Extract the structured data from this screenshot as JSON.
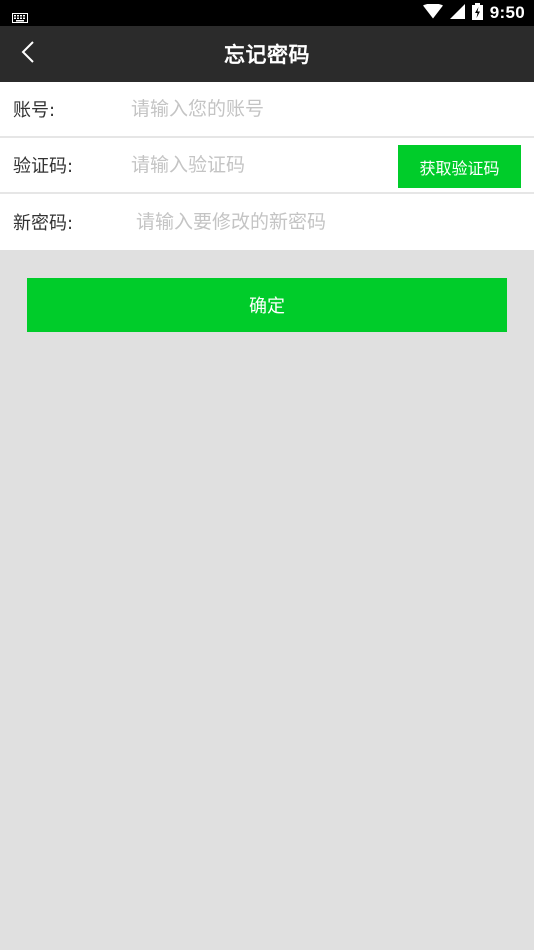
{
  "status_bar": {
    "time": "9:50",
    "icons": [
      "keyboard-icon",
      "wifi-icon",
      "cellular-signal-icon",
      "battery-charging-icon"
    ]
  },
  "header": {
    "title": "忘记密码",
    "back_icon": "chevron-left-icon"
  },
  "form": {
    "account": {
      "label": "账号:",
      "placeholder": "请输入您的账号",
      "value": ""
    },
    "code": {
      "label": "验证码:",
      "placeholder": "请输入验证码",
      "value": "",
      "get_code_label": "获取验证码"
    },
    "new_password": {
      "label": "新密码:",
      "placeholder": "请输入要修改的新密码",
      "value": ""
    }
  },
  "confirm_label": "确定",
  "colors": {
    "accent": "#00cc2a",
    "nav_background": "#2b2b2b",
    "page_background": "#e0e0e0"
  }
}
